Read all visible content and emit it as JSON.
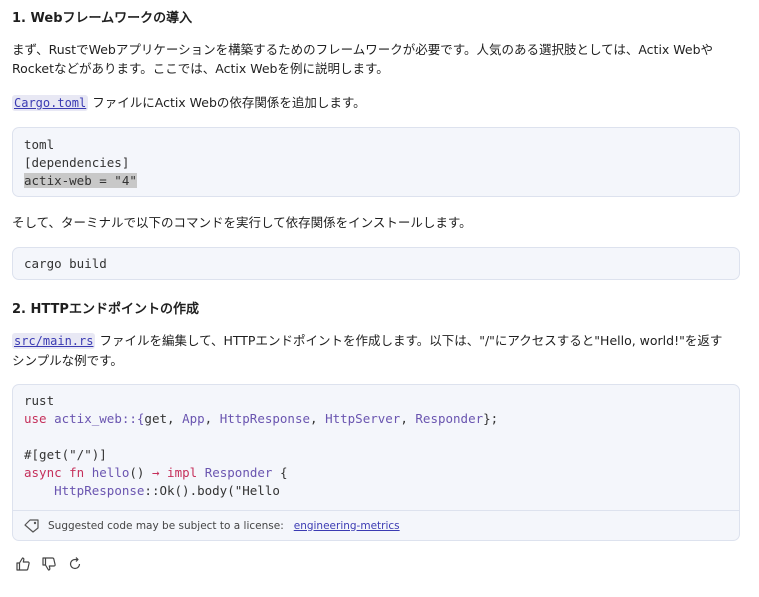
{
  "section1": {
    "heading": "1. Webフレームワークの導入",
    "intro_line1": "まず、RustでWebアプリケーションを構築するためのフレームワークが必要です。人気のある選択肢としては、Actix Webや",
    "intro_line2": "Rocketなどがあります。ここでは、Actix Webを例に説明します。",
    "cargo_file": "Cargo.toml",
    "cargo_text": "ファイルにActix Webの依存関係を追加します。",
    "toml_block": {
      "line1": "toml",
      "line2": "[dependencies]",
      "line3": "actix-web = \"4\""
    },
    "install_text": "そして、ターミナルで以下のコマンドを実行して依存関係をインストールします。",
    "build_block": "cargo build"
  },
  "section2": {
    "heading": "2. HTTPエンドポイントの作成",
    "main_file": "src/main.rs",
    "desc_line1": "ファイルを編集して、HTTPエンドポイントを作成します。以下は、\"/\"にアクセスすると\"Hello, world!\"を返す",
    "desc_line2": "シンプルな例です。",
    "rust_block": {
      "lang": "rust",
      "use_kw": "use",
      "use_path": "actix_web::{",
      "t_get": "get",
      "t_app": "App",
      "t_resp": "HttpResponse",
      "t_server": "HttpServer",
      "t_responder": "Responder",
      "attr": "#[get(\"/\")]",
      "async_kw": "async fn",
      "fn_name": "hello",
      "parens": "()",
      "arrow": "→",
      "impl_kw": "impl",
      "ret_type": "Responder",
      "brace": "{",
      "body_type": "HttpResponse",
      "body_rest": "::Ok().body(\"Hello"
    },
    "license": {
      "text": "Suggested code may be subject to a license:",
      "link": "engineering-metrics"
    }
  },
  "feedback": {
    "icons": [
      "thumbs-up-icon",
      "thumbs-down-icon",
      "refresh-icon"
    ]
  }
}
